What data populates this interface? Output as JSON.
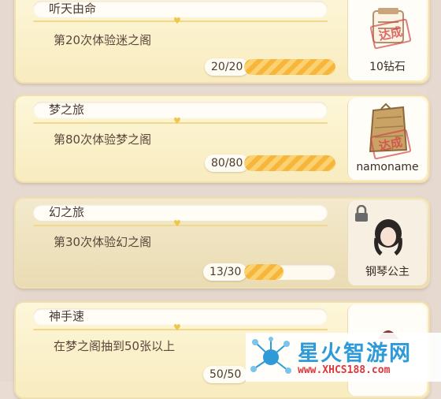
{
  "achievements": [
    {
      "title": "听天由命",
      "description": "第20次体验迷之阁",
      "count": "20/20",
      "progress": 1.0,
      "reward": "10钻石",
      "reward_icon": "prize-scroll",
      "stamp": "达成",
      "locked": false
    },
    {
      "title": "梦之旅",
      "description": "第80次体验梦之阁",
      "count": "80/80",
      "progress": 1.0,
      "reward": "namoname",
      "reward_icon": "burlap-sack",
      "stamp": "达成",
      "locked": false
    },
    {
      "title": "幻之旅",
      "description": "第30次体验幻之阁",
      "count": "13/30",
      "progress": 0.43,
      "reward": "钢琴公主",
      "reward_icon": "hairstyle-portrait",
      "locked": true
    },
    {
      "title": "神手速",
      "description": "在梦之阁抽到50张以上",
      "count": "50/50",
      "progress": 1.0,
      "reward": "",
      "reward_icon": "partial-item",
      "locked": false
    }
  ],
  "watermark": {
    "title": "星火智游网",
    "url": "www.XHCS188.com"
  },
  "colors": {
    "card": "#f8ecbf",
    "progress": "#f7b53a",
    "stamp": "#d24646",
    "watermark_blue": "#2e9bd8",
    "watermark_red": "#e0373a"
  }
}
